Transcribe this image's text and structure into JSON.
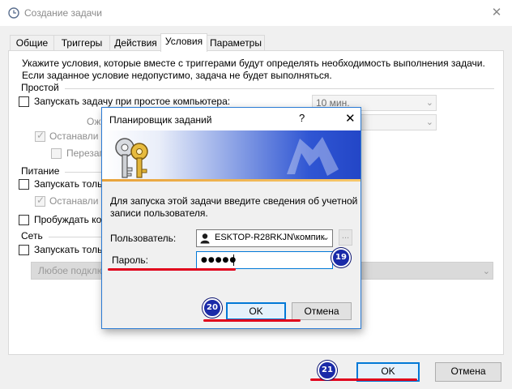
{
  "window": {
    "title": "Создание задачи",
    "close_glyph": "✕"
  },
  "tabs": [
    {
      "label": "Общие"
    },
    {
      "label": "Триггеры"
    },
    {
      "label": "Действия"
    },
    {
      "label": "Условия"
    },
    {
      "label": "Параметры"
    }
  ],
  "conditions": {
    "intro_line1": "Укажите условия, которые вместе с триггерами будут определять необходимость выполнения задачи.",
    "intro_line2": "Если заданное условие недопустимо, задача не будет выполняться.",
    "idle": {
      "group": "Простой",
      "start_if_idle": "Запускать задачу при простое компьютера:",
      "idle_for_value": "10 мин.",
      "wait_label": "Ож",
      "stop_label": "Останавли",
      "restart_label": "Перезап"
    },
    "power": {
      "group": "Питание",
      "start_on_ac": "Запускать толь",
      "stop_label": "Останавли",
      "wake": "Пробуждать ко"
    },
    "network": {
      "group": "Сеть",
      "start_if_network": "Запускать толь",
      "connection_value": "Любое подклю"
    }
  },
  "dialog": {
    "title": "Планировщик заданий",
    "help_glyph": "?",
    "close_glyph": "✕",
    "message_line1": "Для запуска этой задачи введите сведения об учетной",
    "message_line2": "записи пользователя.",
    "user_label": "Пользователь:",
    "user_value": "ESKTOP-R28RKJN\\компик",
    "browse_label": "...",
    "password_label": "Пароль:",
    "password_value": "●●●●●",
    "ok_label": "OK",
    "cancel_label": "Отмена"
  },
  "footer": {
    "ok_label": "OK",
    "cancel_label": "Отмена"
  },
  "annotations": {
    "badge_password": "19",
    "badge_dialog_ok": "20",
    "badge_main_ok": "21"
  },
  "colors": {
    "accent": "#0078d7",
    "annotation_badge": "#1a2aa8",
    "annotation_underline": "#e0001b"
  }
}
